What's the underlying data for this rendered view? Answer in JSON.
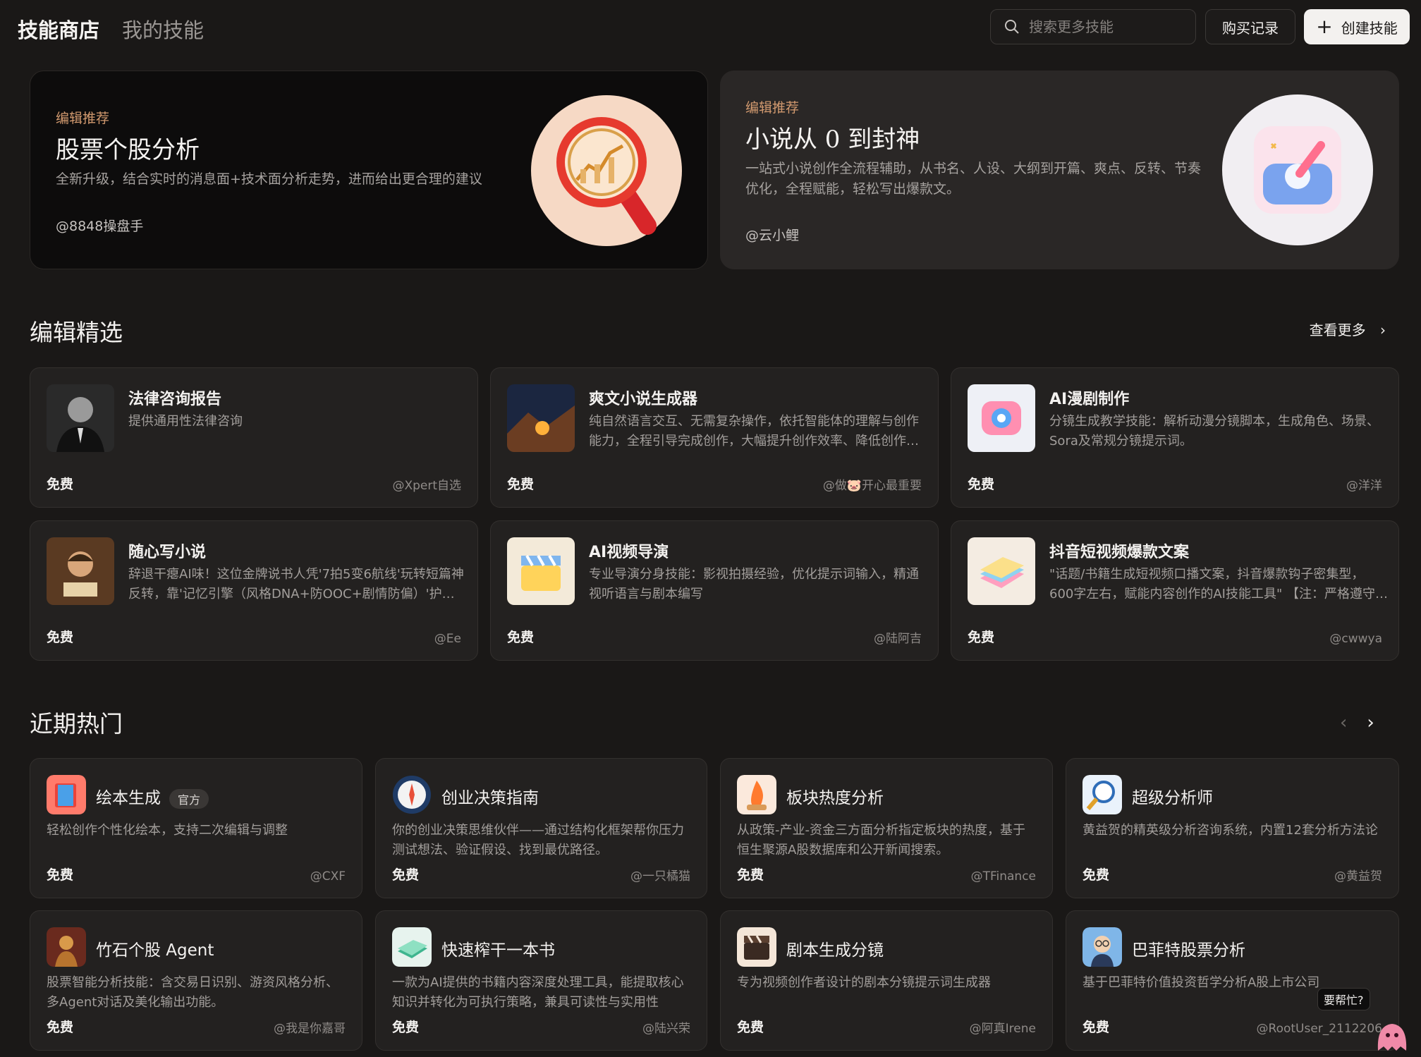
{
  "header": {
    "tab_store": "技能商店",
    "tab_mine": "我的技能",
    "search_placeholder": "搜索更多技能",
    "history_label": "购买记录",
    "create_label": "创建技能"
  },
  "heroes": [
    {
      "tag": "编辑推荐",
      "title": "股票个股分析",
      "desc": "全新升级，结合实时的消息面+技术面分析走势，进而给出更合理的建议",
      "author": "@8848操盘手",
      "icon": "magnifier-chart-icon"
    },
    {
      "tag": "编辑推荐",
      "title": "小说从 0 到封神",
      "desc": "一站式小说创作全流程辅助，从书名、人设、大纲到开篇、爽点、反转、节奏优化，全程赋能，轻松写出爆款文。",
      "author": "@云小鲤",
      "icon": "writing-box-icon"
    }
  ],
  "featured": {
    "title": "编辑精选",
    "see_more": "查看更多",
    "cards": [
      {
        "title": "法律咨询报告",
        "desc": "提供通用性法律咨询",
        "price": "免费",
        "author": "@Xpert自选",
        "icon": "lawyer-portrait-icon"
      },
      {
        "title": "爽文小说生成器",
        "desc": "纯自然语言交互、无需复杂操作，依托智能体的理解与创作能力，全程引导完成创作，大幅提升创作效率、降低创作门槛",
        "price": "免费",
        "author": "@做🐷开心最重要",
        "icon": "night-scene-icon"
      },
      {
        "title": "AI漫剧制作",
        "desc": "分镜生成教学技能：解析动漫分镜脚本，生成角色、场景、Sora及常规分镜提示词。",
        "price": "免费",
        "author": "@洋洋",
        "icon": "camera-icon"
      },
      {
        "title": "随心写小说",
        "desc": "辞退干瘪AI味！这位金牌说书人凭'7拍5变6航线'玩转短篇神反转，靠'记忆引擎（风格DNA+防OOC+剧情防偏）'护航全篇",
        "price": "免费",
        "author": "@Ee",
        "icon": "storyteller-portrait-icon"
      },
      {
        "title": "AI视频导演",
        "desc": "专业导演分身技能：影视拍摄经验，优化提示词输入，精通视听语言与剧本编写",
        "price": "免费",
        "author": "@陆阿吉",
        "icon": "clapperboard-icon"
      },
      {
        "title": "抖音短视频爆款文案",
        "desc": "\"话题/书籍生成短视频口播文案，抖音爆款钩子密集型，600字左右，赋能内容创作的AI技能工具\" 【注：严格遵守平台规范】",
        "price": "免费",
        "author": "@cwwya",
        "icon": "book-stack-icon"
      }
    ]
  },
  "trending": {
    "title": "近期热门",
    "badge": "官方",
    "cards": [
      {
        "title": "绘本生成",
        "official": true,
        "desc": "轻松创作个性化绘本，支持二次编辑与调整",
        "price": "免费",
        "author": "@CXF",
        "icon": "picture-book-icon"
      },
      {
        "title": "创业决策指南",
        "official": false,
        "desc": "你的创业决策思维伙伴——通过结构化框架帮你压力测试想法、验证假设、找到最优路径。",
        "price": "免费",
        "author": "@一只橘猫",
        "icon": "compass-icon"
      },
      {
        "title": "板块热度分析",
        "official": false,
        "desc": "从政策-产业-资金三方面分析指定板块的热度，基于恒生聚源A股数据库和公开新闻搜索。",
        "price": "免费",
        "author": "@TFinance",
        "icon": "flame-icon"
      },
      {
        "title": "超级分析师",
        "official": false,
        "desc": "黄益贺的精英级分析咨询系统，内置12套分析方法论",
        "price": "免费",
        "author": "@黄益贺",
        "icon": "analyst-magnifier-icon"
      },
      {
        "title": "竹石个股 Agent",
        "official": false,
        "desc": "股票智能分析技能：含交易日识别、游资风格分析、多Agent对话及美化输出功能。",
        "price": "免费",
        "author": "@我是你嘉哥",
        "icon": "bamboo-stone-icon"
      },
      {
        "title": "快速榨干一本书",
        "official": false,
        "desc": "一款为AI提供的书籍内容深度处理工具，能提取核心知识并转化为可执行策略，兼具可读性与实用性",
        "price": "免费",
        "author": "@陆兴荣",
        "icon": "green-book-icon"
      },
      {
        "title": "剧本生成分镜",
        "official": false,
        "desc": "专为视频创作者设计的剧本分镜提示词生成器",
        "price": "免费",
        "author": "@阿真Irene",
        "icon": "film-clapper-icon"
      },
      {
        "title": "巴菲特股票分析",
        "official": false,
        "desc": "基于巴菲特价值投资哲学分析A股上市公司",
        "price": "免费",
        "author": "@RootUser_2112206",
        "icon": "buffett-avatar-icon"
      }
    ]
  },
  "help_label": "要帮忙?"
}
